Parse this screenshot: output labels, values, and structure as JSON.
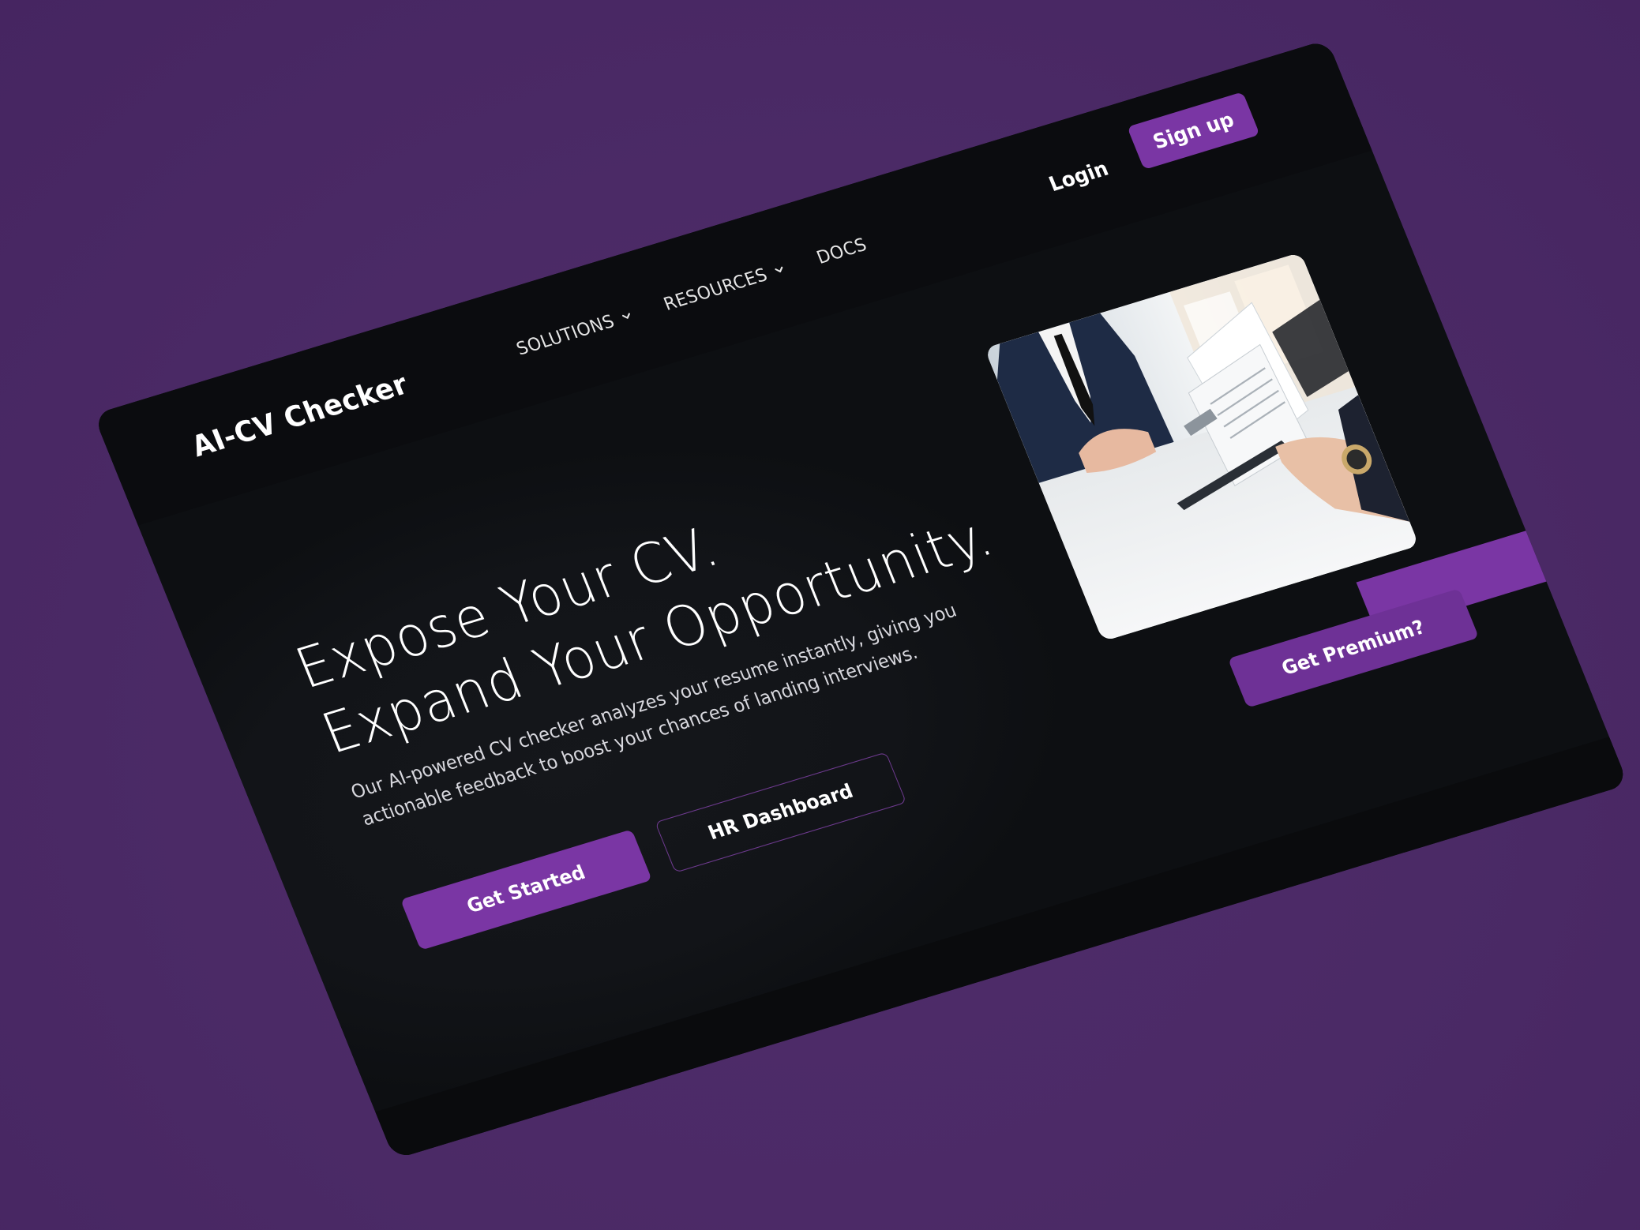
{
  "brand": {
    "name": "AI-CV Checker"
  },
  "nav": {
    "items": [
      {
        "label": "SOLUTIONS",
        "has_dropdown": true
      },
      {
        "label": "RESOURCES",
        "has_dropdown": true
      },
      {
        "label": "DOCS",
        "has_dropdown": false
      }
    ],
    "login_label": "Login",
    "signup_label": "Sign up"
  },
  "hero": {
    "title_line1": "Expose Your CV.",
    "title_line2": "Expand Your Opportunity.",
    "description": "Our AI-powered CV checker analyzes your resume instantly, giving you actionable feedback to boost your chances of landing interviews.",
    "primary_cta": "Get Started",
    "secondary_cta": "HR Dashboard",
    "image_icon": "business-meeting-photo"
  },
  "premium": {
    "label": "Get Premium?"
  },
  "colors": {
    "background": "#4b2a66",
    "screen": "#0d0f12",
    "accent": "#7a36a4",
    "text": "#ffffff"
  }
}
